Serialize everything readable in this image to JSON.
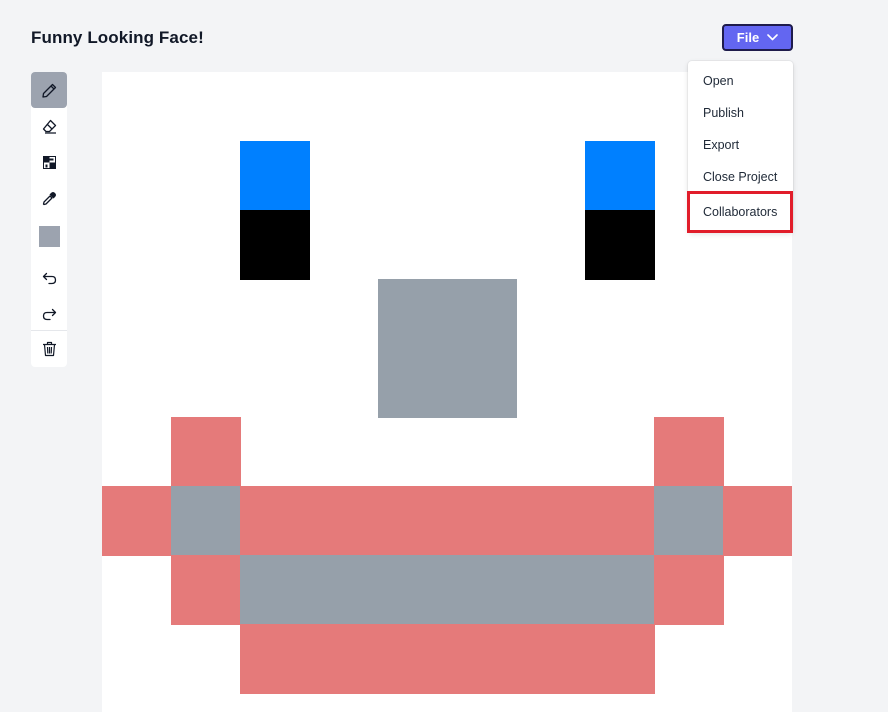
{
  "page": {
    "title": "Funny Looking Face!"
  },
  "file_button": {
    "label": "File",
    "icon": "chevron-down-icon",
    "color": "#6366f1"
  },
  "file_menu": {
    "items": [
      {
        "label": "Open"
      },
      {
        "label": "Publish"
      },
      {
        "label": "Export"
      },
      {
        "label": "Close Project"
      },
      {
        "label": "Collaborators",
        "highlighted": true
      }
    ],
    "highlight_color": "#e11d2a"
  },
  "toolbar": {
    "tools": [
      {
        "name": "pencil-icon",
        "active": true
      },
      {
        "name": "eraser-icon",
        "active": false
      },
      {
        "name": "fill-icon",
        "active": false
      },
      {
        "name": "eyedropper-icon",
        "active": false
      },
      {
        "name": "current-color-swatch",
        "color": "#9ca3af"
      },
      {
        "name": "undo-icon"
      },
      {
        "name": "redo-icon"
      },
      {
        "name": "trash-icon"
      }
    ]
  },
  "pixel_canvas": {
    "grid_columns": 10,
    "background": "#ffffff",
    "palette": {
      "blue": "#0080ff",
      "black": "#000000",
      "gray": "#96a0aa",
      "red": "#e57a7a"
    },
    "pixels": [
      {
        "col": 2,
        "row": 1,
        "color": "blue"
      },
      {
        "col": 2,
        "row": 2,
        "color": "black"
      },
      {
        "col": 7,
        "row": 1,
        "color": "blue"
      },
      {
        "col": 7,
        "row": 2,
        "color": "black"
      },
      {
        "col": 4,
        "row": 3,
        "color": "gray"
      },
      {
        "col": 5,
        "row": 3,
        "color": "gray"
      },
      {
        "col": 4,
        "row": 4,
        "color": "gray"
      },
      {
        "col": 5,
        "row": 4,
        "color": "gray"
      },
      {
        "col": 1,
        "row": 5,
        "color": "red"
      },
      {
        "col": 8,
        "row": 5,
        "color": "red"
      },
      {
        "col": 0,
        "row": 6,
        "color": "red"
      },
      {
        "col": 1,
        "row": 6,
        "color": "gray"
      },
      {
        "col": 2,
        "row": 6,
        "color": "red"
      },
      {
        "col": 3,
        "row": 6,
        "color": "red"
      },
      {
        "col": 4,
        "row": 6,
        "color": "red"
      },
      {
        "col": 5,
        "row": 6,
        "color": "red"
      },
      {
        "col": 6,
        "row": 6,
        "color": "red"
      },
      {
        "col": 7,
        "row": 6,
        "color": "red"
      },
      {
        "col": 8,
        "row": 6,
        "color": "gray"
      },
      {
        "col": 9,
        "row": 6,
        "color": "red"
      },
      {
        "col": 1,
        "row": 7,
        "color": "red"
      },
      {
        "col": 2,
        "row": 7,
        "color": "gray"
      },
      {
        "col": 3,
        "row": 7,
        "color": "gray"
      },
      {
        "col": 4,
        "row": 7,
        "color": "gray"
      },
      {
        "col": 5,
        "row": 7,
        "color": "gray"
      },
      {
        "col": 6,
        "row": 7,
        "color": "gray"
      },
      {
        "col": 7,
        "row": 7,
        "color": "gray"
      },
      {
        "col": 8,
        "row": 7,
        "color": "red"
      },
      {
        "col": 2,
        "row": 8,
        "color": "red"
      },
      {
        "col": 3,
        "row": 8,
        "color": "red"
      },
      {
        "col": 4,
        "row": 8,
        "color": "red"
      },
      {
        "col": 5,
        "row": 8,
        "color": "red"
      },
      {
        "col": 6,
        "row": 8,
        "color": "red"
      },
      {
        "col": 7,
        "row": 8,
        "color": "red"
      }
    ]
  }
}
